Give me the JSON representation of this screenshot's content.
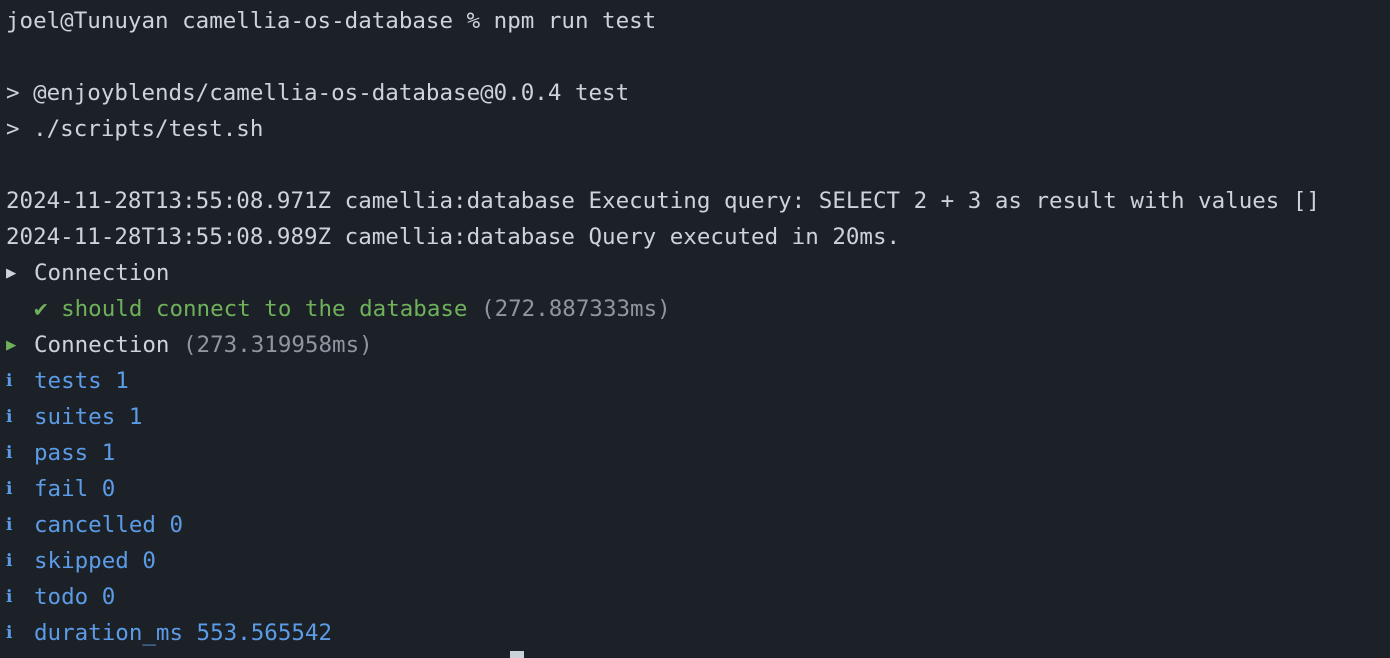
{
  "prompt": {
    "text": "joel@Tunuyan camellia-os-database % npm run test"
  },
  "npm_header": [
    "> @enjoyblends/camellia-os-database@0.0.4 test",
    "> ./scripts/test.sh"
  ],
  "logs": [
    "2024-11-28T13:55:08.971Z camellia:database Executing query: SELECT 2 + 3 as result with values []",
    "2024-11-28T13:55:08.989Z camellia:database Query executed in 20ms."
  ],
  "suite_start": {
    "arrow": "▶",
    "name": "Connection"
  },
  "test_pass": {
    "check": "✔",
    "name": "should connect to the database",
    "time": "(272.887333ms)"
  },
  "suite_end": {
    "arrow": "▶",
    "name": "Connection",
    "time": "(273.319958ms)"
  },
  "summary": {
    "icon": "ℹ",
    "items": [
      "tests 1",
      "suites 1",
      "pass 1",
      "fail 0",
      "cancelled 0",
      "skipped 0",
      "todo 0",
      "duration_ms 553.565542"
    ]
  },
  "colors": {
    "background": "#1c2128",
    "text": "#cdd3db",
    "pass": "#6fb15a",
    "dim": "#8e96a0",
    "info": "#5c9be6"
  }
}
